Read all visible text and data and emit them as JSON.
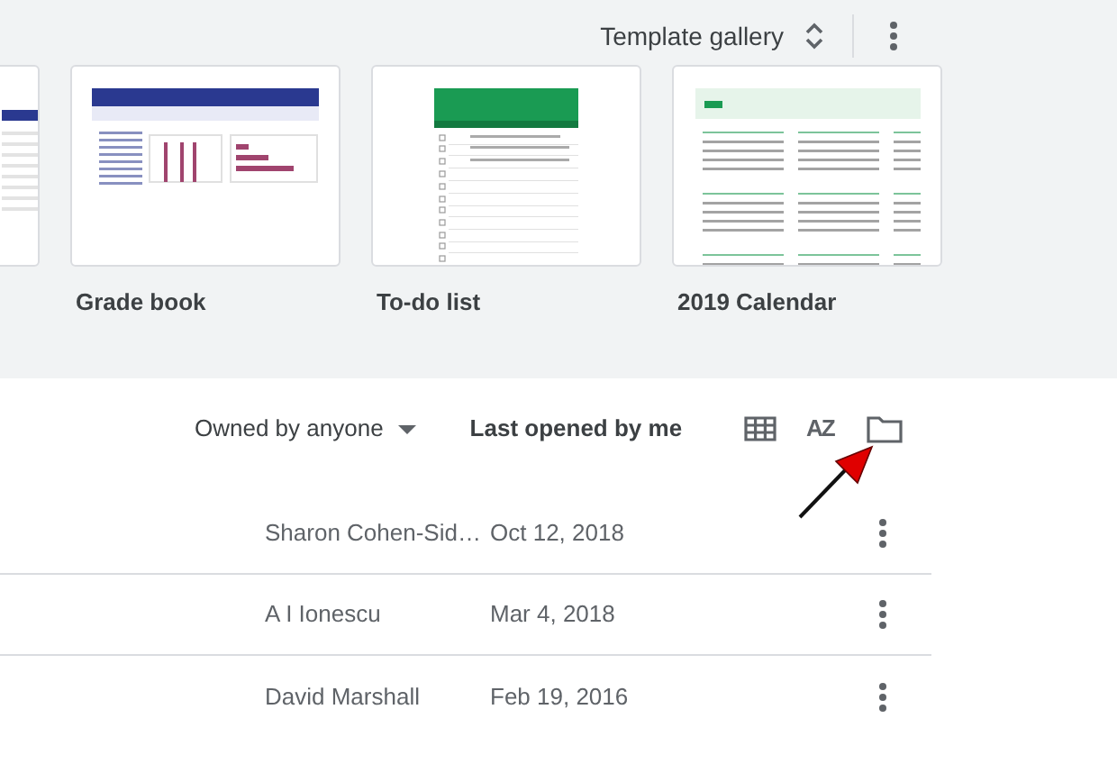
{
  "header": {
    "template_gallery": "Template gallery"
  },
  "templates": [
    {
      "kind": "roster"
    },
    {
      "kind": "gradebook",
      "title": "Grade book"
    },
    {
      "kind": "todo",
      "title": "To-do list"
    },
    {
      "kind": "calendar",
      "title": "2019 Calendar"
    }
  ],
  "toolbar": {
    "owner_filter": "Owned by anyone",
    "sort": "Last opened by me",
    "sort_icon": "AZ"
  },
  "files": [
    {
      "owner": "Sharon Cohen-Sid…",
      "date": "Oct 12, 2018"
    },
    {
      "owner": "A I Ionescu",
      "date": "Mar 4, 2018"
    },
    {
      "owner": "David Marshall",
      "date": "Feb 19, 2016"
    }
  ]
}
